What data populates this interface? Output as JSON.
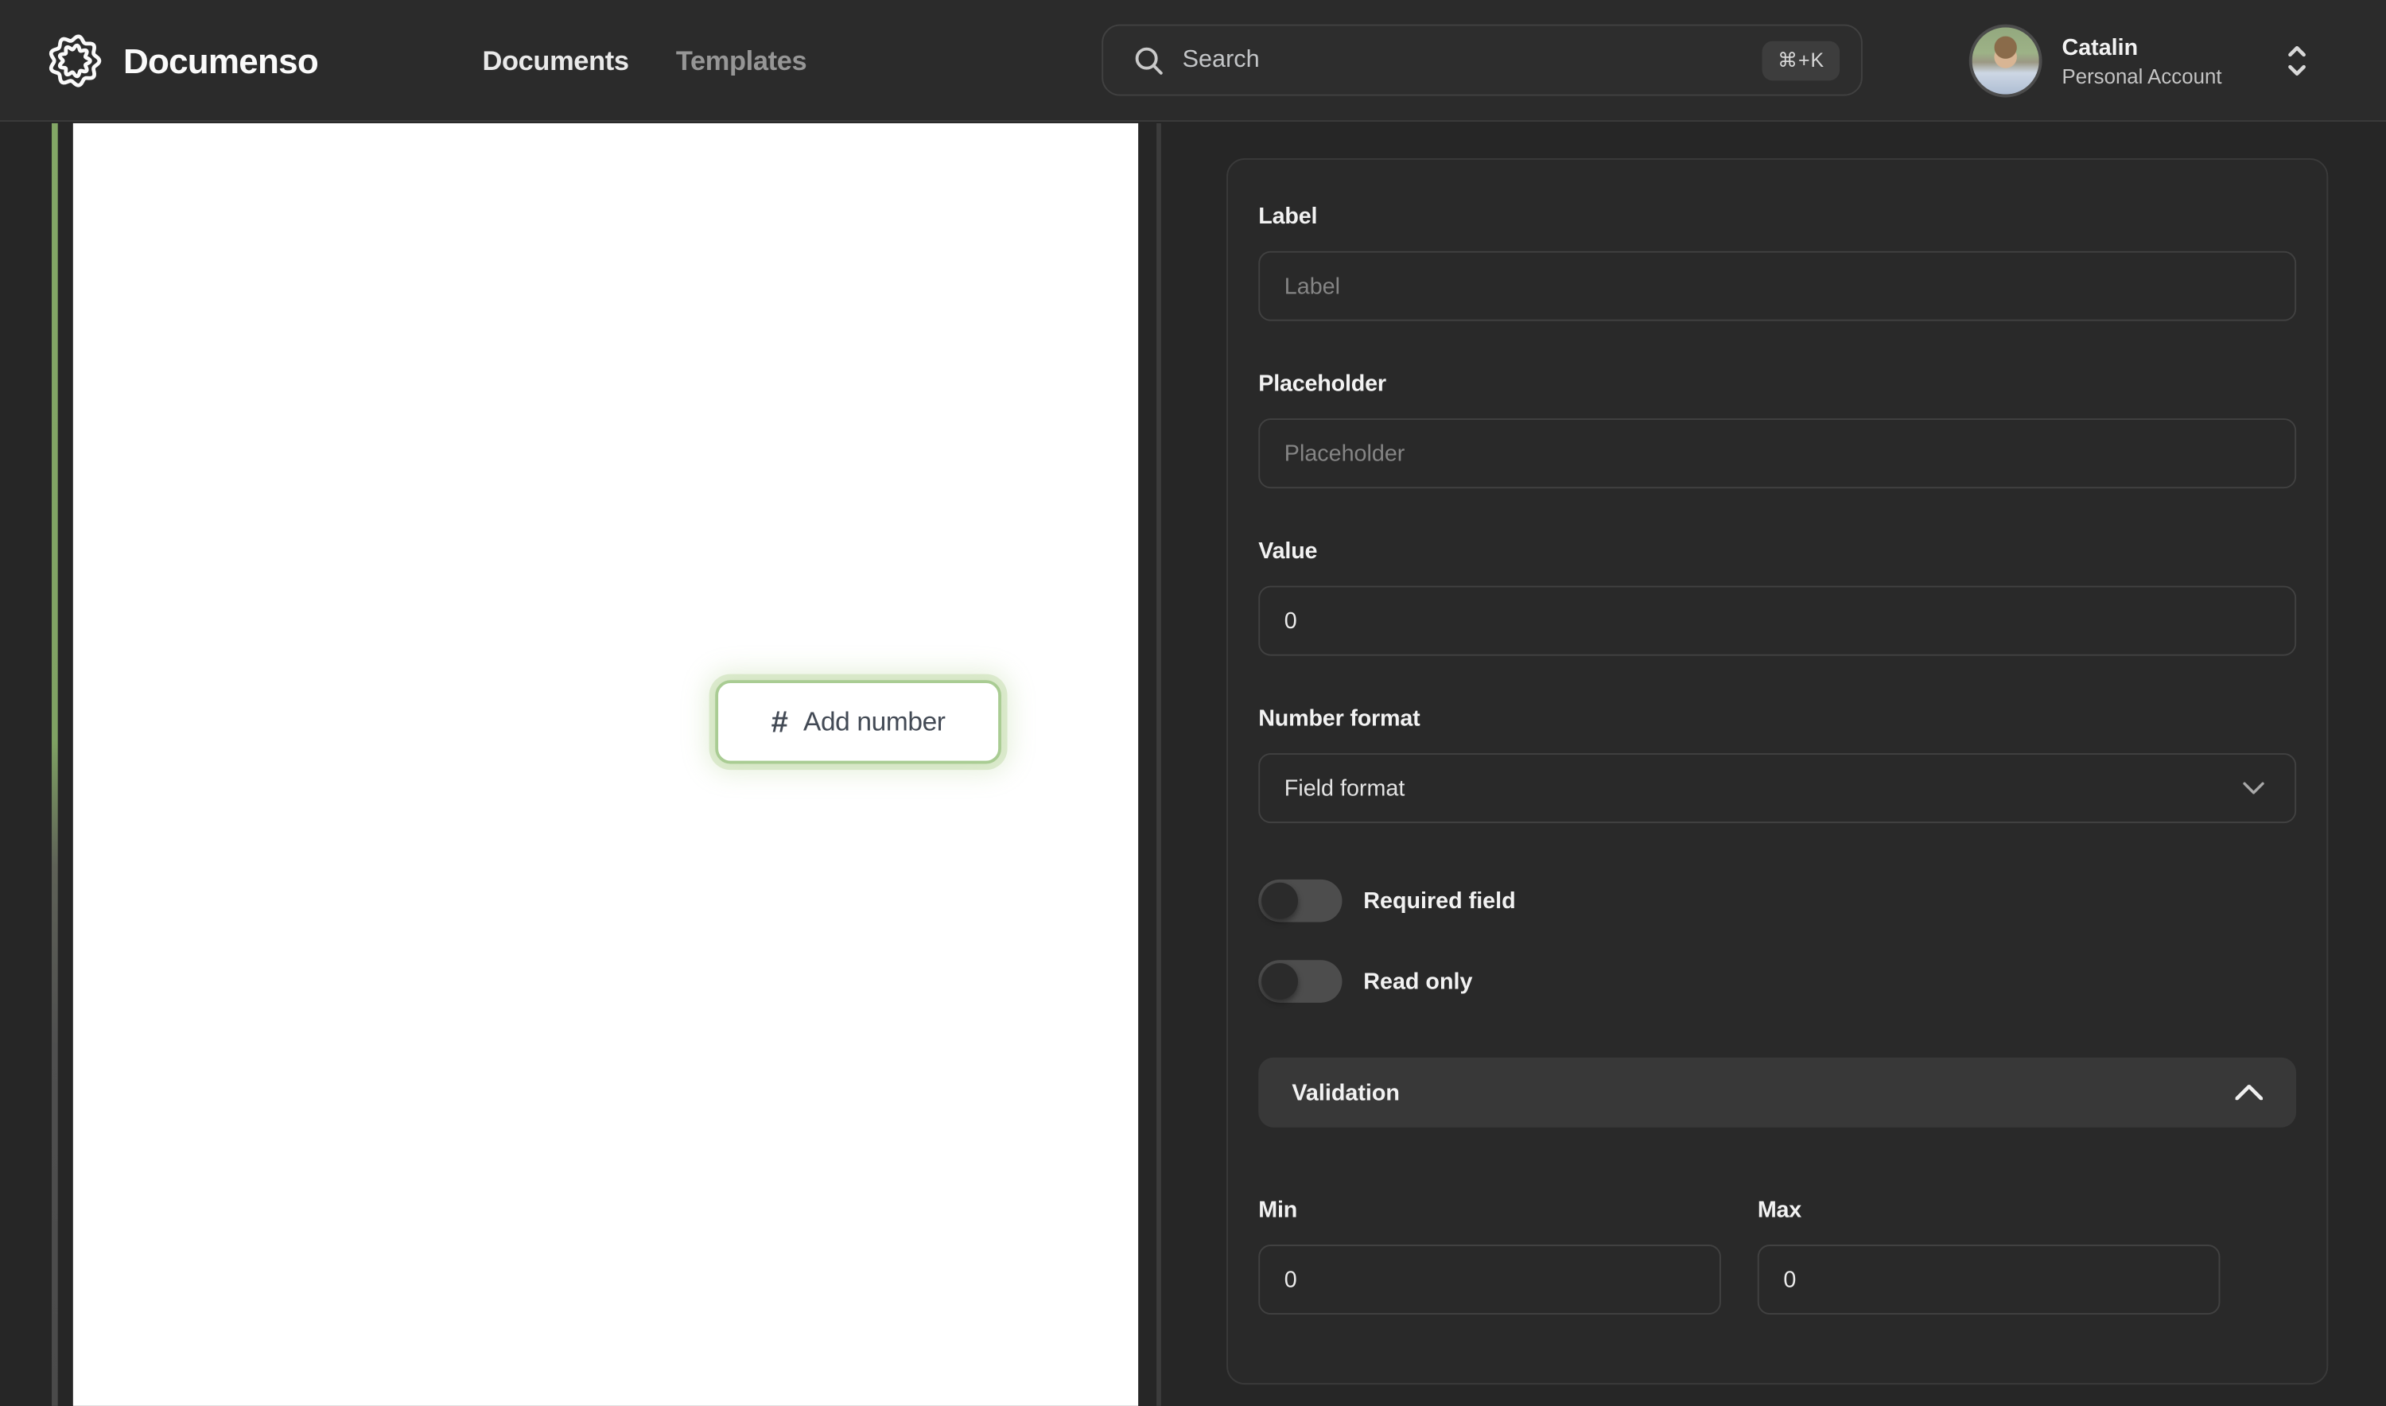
{
  "navbar": {
    "brand": "Documenso",
    "items": [
      {
        "label": "Documents",
        "active": true
      },
      {
        "label": "Templates",
        "active": false
      }
    ],
    "search": {
      "placeholder": "Search",
      "shortcut": "⌘+K"
    },
    "user": {
      "name": "Catalin",
      "account_type": "Personal Account"
    }
  },
  "document": {
    "add_number_button": {
      "icon": "#",
      "label": "Add number"
    }
  },
  "panel": {
    "label_field": {
      "heading": "Label",
      "placeholder": "Label",
      "value": ""
    },
    "placeholder_field": {
      "heading": "Placeholder",
      "placeholder": "Placeholder",
      "value": ""
    },
    "value_field": {
      "heading": "Value",
      "value": "0"
    },
    "number_format": {
      "heading": "Number format",
      "selected": "Field format"
    },
    "toggles": [
      {
        "label": "Required field",
        "state": "off"
      },
      {
        "label": "Read only",
        "state": "off"
      }
    ],
    "validation": {
      "title": "Validation",
      "expanded": true
    },
    "min_field": {
      "heading": "Min",
      "value": "0"
    },
    "max_field": {
      "heading": "Max",
      "value": "0"
    }
  },
  "colors": {
    "accent_green": "#a9cc93",
    "page_background": "#262626",
    "navbar_background": "#2b2b2b",
    "card_background": "#292929",
    "document_page": "#ffffff"
  }
}
